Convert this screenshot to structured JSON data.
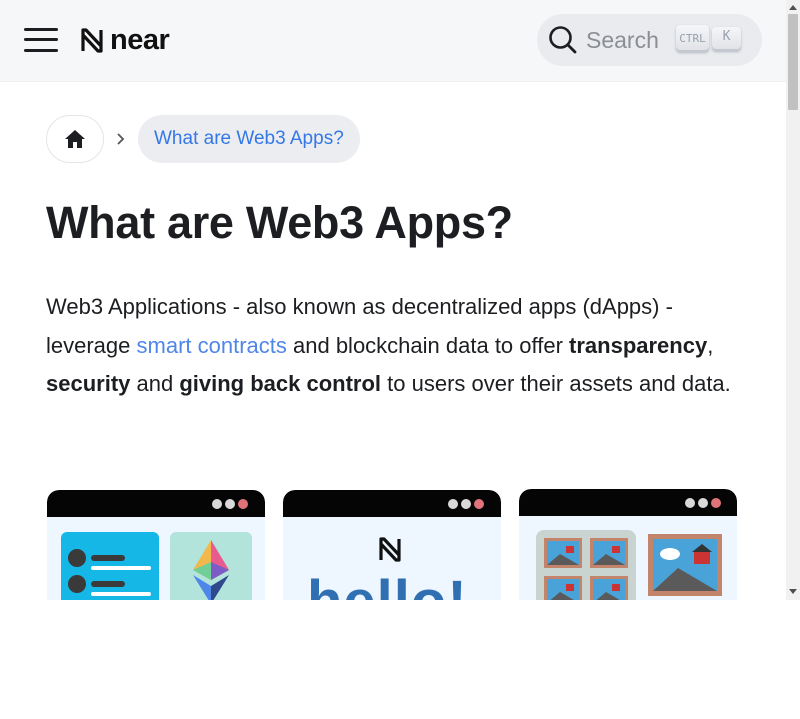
{
  "header": {
    "logo_text": "near",
    "menu_icon": "hamburger-menu-icon",
    "search": {
      "placeholder": "Search",
      "shortcut_modifier": "CTRL",
      "shortcut_key": "K"
    }
  },
  "breadcrumb": {
    "home_icon": "home-icon",
    "separator_icon": "chevron-right-icon",
    "current": "What are Web3 Apps?"
  },
  "page": {
    "title": "What are Web3 Apps?",
    "intro": {
      "part1": "Web3 Applications - also known as decentralized apps (dApps) - leverage ",
      "link": "smart contracts",
      "part2": " and blockchain data to offer ",
      "bold1": "transparency",
      "comma": ", ",
      "bold2": "security",
      "and": " and ",
      "bold3": "giving back control",
      "part3": " to users over their assets and data."
    }
  },
  "cards": [
    {
      "name": "list-app-illustration",
      "icons": [
        "list-icon",
        "ethereum-icon"
      ]
    },
    {
      "name": "hello-near-illustration",
      "text": "hello!"
    },
    {
      "name": "gallery-app-illustration",
      "icons": [
        "picture-grid-icon",
        "picture-icon"
      ]
    }
  ],
  "colors": {
    "accent_link": "#4f87e9",
    "breadcrumb_active": "#3578e5",
    "navbar_bg": "#f6f7f9",
    "card_bar": "#050505",
    "window_dots": [
      "#d9d9d9",
      "#d9d9d9",
      "#e0737a"
    ]
  }
}
